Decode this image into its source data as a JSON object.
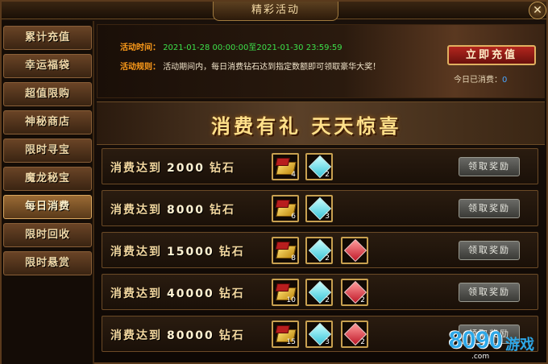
{
  "window": {
    "title": "精彩活动",
    "close_symbol": "✕"
  },
  "sidebar": {
    "items": [
      {
        "label": "累计充值"
      },
      {
        "label": "幸运福袋"
      },
      {
        "label": "超值限购"
      },
      {
        "label": "神秘商店"
      },
      {
        "label": "限时寻宝"
      },
      {
        "label": "魔龙秘宝"
      },
      {
        "label": "每日消费",
        "active": true
      },
      {
        "label": "限时回收"
      },
      {
        "label": "限时悬赏"
      }
    ]
  },
  "info": {
    "time_label": "活动时间：",
    "time_start": "2021-01-28 00:00:00",
    "time_sep": "至",
    "time_end": "2021-01-30 23:59:59",
    "rule_label": "活动规则：",
    "rule_text": "活动期间内，每日消费钻石达到指定数额即可领取豪华大奖！",
    "recharge_label": "立即充值",
    "today_label": "今日已消费：",
    "today_value": "0"
  },
  "banner": {
    "text": "消费有礼  天天惊喜"
  },
  "rows": [
    {
      "prefix": "消费达到",
      "amount": "2000",
      "unit": "钻石",
      "items": [
        {
          "kind": "gold-bar",
          "count": "4"
        },
        {
          "kind": "cyan-gem",
          "count": "2"
        }
      ],
      "button": "领取奖励"
    },
    {
      "prefix": "消费达到",
      "amount": "8000",
      "unit": "钻石",
      "items": [
        {
          "kind": "gold-bar",
          "count": "6"
        },
        {
          "kind": "cyan-gem",
          "count": "3"
        }
      ],
      "button": "领取奖励"
    },
    {
      "prefix": "消费达到",
      "amount": "15000",
      "unit": "钻石",
      "items": [
        {
          "kind": "gold-bar",
          "count": "8"
        },
        {
          "kind": "cyan-gem",
          "count": "2"
        },
        {
          "kind": "red-gem",
          "count": ""
        }
      ],
      "button": "领取奖励"
    },
    {
      "prefix": "消费达到",
      "amount": "40000",
      "unit": "钻石",
      "items": [
        {
          "kind": "gold-bar",
          "count": "10"
        },
        {
          "kind": "cyan-gem",
          "count": "2"
        },
        {
          "kind": "red-gem",
          "count": "2"
        }
      ],
      "button": "领取奖励"
    },
    {
      "prefix": "消费达到",
      "amount": "80000",
      "unit": "钻石",
      "items": [
        {
          "kind": "gold-bar",
          "count": "15"
        },
        {
          "kind": "cyan-gem",
          "count": "3"
        },
        {
          "kind": "red-gem",
          "count": "2"
        }
      ],
      "button": "领取奖励"
    }
  ],
  "watermark": {
    "number": "8090",
    "domain": ".com",
    "cn": "游戏"
  },
  "colors": {
    "accent_gold": "#c8a050",
    "label_orange": "#ff9c1a",
    "time_green": "#3de04a",
    "value_blue": "#4aa7ff",
    "recharge_red": "#b3261e"
  }
}
